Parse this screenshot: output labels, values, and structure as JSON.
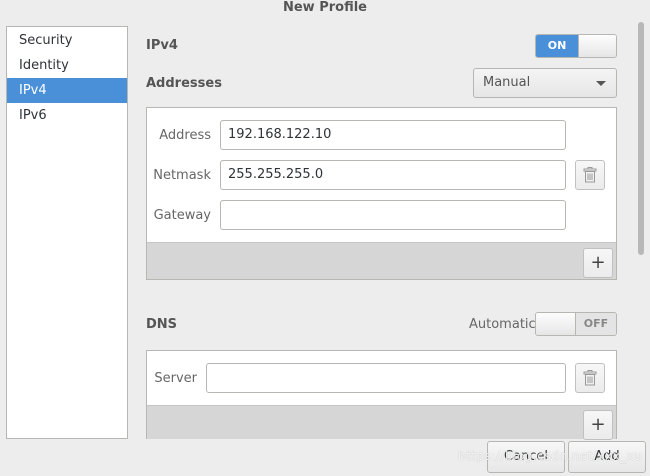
{
  "window": {
    "title": "New Profile"
  },
  "sidebar": {
    "items": [
      {
        "label": "Security"
      },
      {
        "label": "Identity"
      },
      {
        "label": "IPv4"
      },
      {
        "label": "IPv6"
      }
    ],
    "selected": "IPv4"
  },
  "ipv4": {
    "label": "IPv4",
    "toggle": {
      "on_label": "ON",
      "state": "on"
    }
  },
  "addresses": {
    "label": "Addresses",
    "method": "Manual",
    "fields": {
      "address": {
        "label": "Address",
        "value": "192.168.122.10"
      },
      "netmask": {
        "label": "Netmask",
        "value": "255.255.255.0"
      },
      "gateway": {
        "label": "Gateway",
        "value": ""
      }
    }
  },
  "dns": {
    "label": "DNS",
    "automatic_label": "Automatic",
    "toggle": {
      "off_label": "OFF",
      "state": "off"
    },
    "server": {
      "label": "Server",
      "value": ""
    }
  },
  "buttons": {
    "cancel": "Cancel",
    "add": "Add"
  },
  "watermark": "https://blog.csdn.net/xxx_xu",
  "colors": {
    "accent": "#4a90d9",
    "background": "#ededed"
  }
}
